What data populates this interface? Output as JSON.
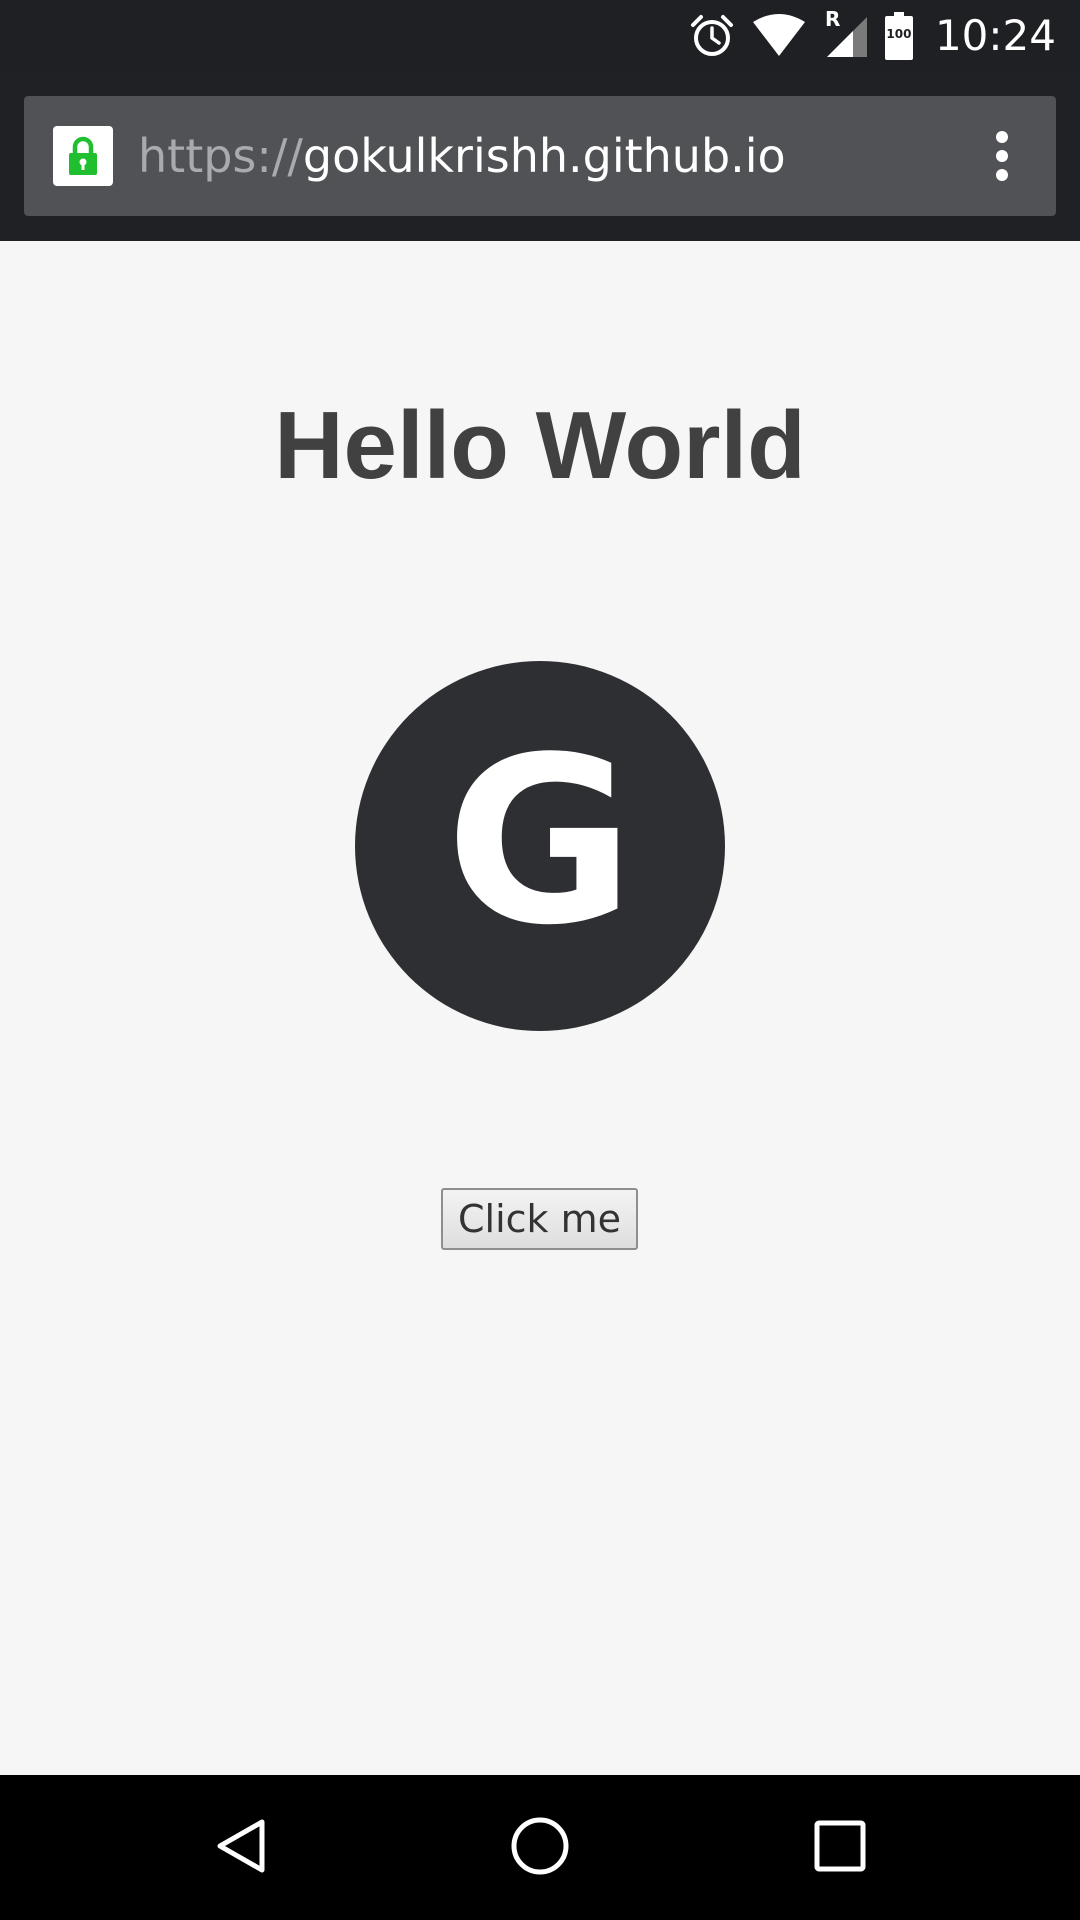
{
  "status_bar": {
    "time": "10:24",
    "battery_level": "100",
    "signal_label": "R",
    "icons": [
      "alarm-icon",
      "wifi-icon",
      "signal-icon",
      "battery-icon"
    ]
  },
  "browser": {
    "url_scheme": "https://",
    "url_host": "gokulkrishh.github.io",
    "lock_color": "#1fbf2f",
    "menu_icon": "overflow-menu-icon"
  },
  "page": {
    "heading": "Hello World",
    "avatar_letter": "G",
    "button_label": "Click me"
  },
  "nav_bar": {
    "icons": [
      "back-icon",
      "home-icon",
      "recents-icon"
    ]
  }
}
